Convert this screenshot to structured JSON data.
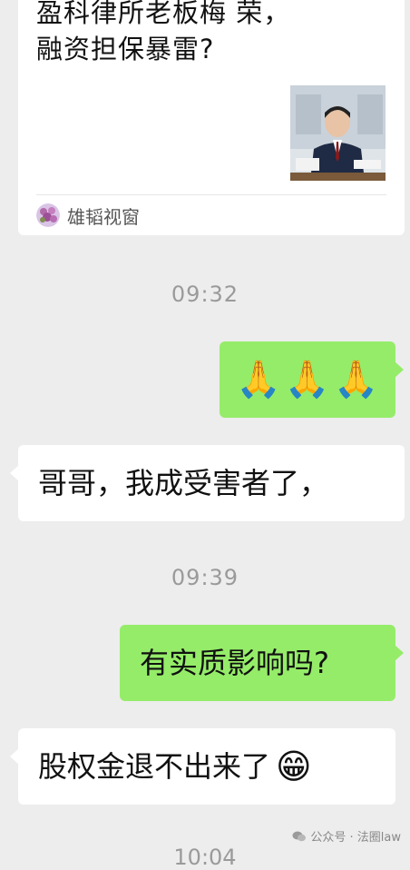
{
  "shared_article": {
    "title": "盈科律所老板梅  荣，\n融资担保暴雷?",
    "source_name": "雄韬视窗"
  },
  "timestamps": {
    "first": "09:32",
    "second": "09:39",
    "third_partial": "10:04"
  },
  "messages": {
    "outgoing_1_emojis": [
      "🙏",
      "🙏",
      "🙏"
    ],
    "incoming_1": "哥哥，我成受害者了，",
    "outgoing_2": "有实质影响吗?",
    "incoming_2_text": "股权金退不出来了",
    "incoming_2_emoji": "😁"
  },
  "watermark": {
    "text": "公众号 · 法圈law"
  },
  "colors": {
    "background": "#ededed",
    "outgoing_bubble": "#95ec69",
    "incoming_bubble": "#ffffff",
    "timestamp_text": "#9a9a9a"
  }
}
